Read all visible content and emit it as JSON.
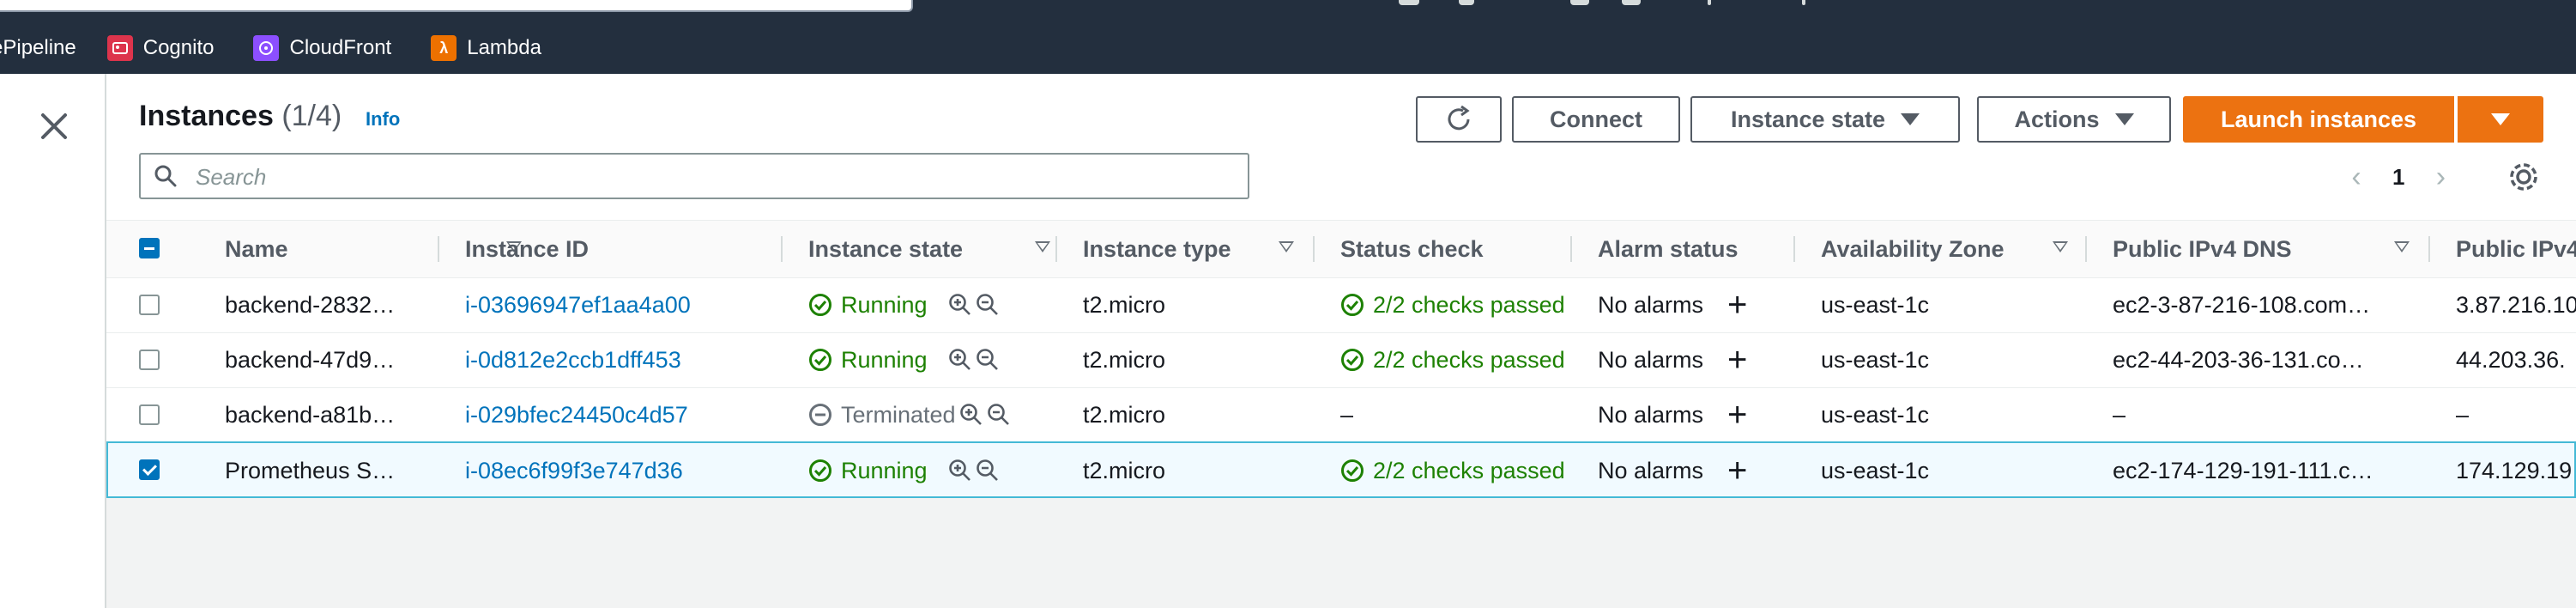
{
  "bookmarks": [
    {
      "label": "ePipeline",
      "icon": "codepipeline-icon",
      "color": ""
    },
    {
      "label": "Cognito",
      "icon": "cognito-icon",
      "color": "#dd344c"
    },
    {
      "label": "CloudFront",
      "icon": "cloudfront-icon",
      "color": "#8c4fff"
    },
    {
      "label": "Lambda",
      "icon": "lambda-icon",
      "color": "#ed7100"
    }
  ],
  "header": {
    "title": "Instances",
    "count": "(1/4)",
    "info": "Info"
  },
  "toolbar": {
    "connect": "Connect",
    "instance_state": "Instance state",
    "actions": "Actions",
    "launch": "Launch instances"
  },
  "search": {
    "placeholder": "Search"
  },
  "pagination": {
    "page": "1"
  },
  "table": {
    "columns": {
      "name": "Name",
      "instance_id": "Instance ID",
      "instance_state": "Instance state",
      "instance_type": "Instance type",
      "status_check": "Status check",
      "alarm_status": "Alarm status",
      "availability_zone": "Availability Zone",
      "public_dns": "Public IPv4 DNS",
      "public_ip": "Public IPv4"
    },
    "rows": [
      {
        "name": "backend-2832…",
        "id": "i-03696947ef1aa4a00",
        "state": "Running",
        "type": "t2.micro",
        "status": "2/2 checks passed",
        "alarm": "No alarms",
        "az": "us-east-1c",
        "dns": "ec2-3-87-216-108.com…",
        "ip": "3.87.216.10"
      },
      {
        "name": "backend-47d9…",
        "id": "i-0d812e2ccb1dff453",
        "state": "Running",
        "type": "t2.micro",
        "status": "2/2 checks passed",
        "alarm": "No alarms",
        "az": "us-east-1c",
        "dns": "ec2-44-203-36-131.co…",
        "ip": "44.203.36."
      },
      {
        "name": "backend-a81b…",
        "id": "i-029bfec24450c4d57",
        "state": "Terminated",
        "type": "t2.micro",
        "status": "–",
        "alarm": "No alarms",
        "az": "us-east-1c",
        "dns": "–",
        "ip": "–"
      },
      {
        "name": "Prometheus S…",
        "id": "i-08ec6f99f3e747d36",
        "state": "Running",
        "type": "t2.micro",
        "status": "2/2 checks passed",
        "alarm": "No alarms",
        "az": "us-east-1c",
        "dns": "ec2-174-129-191-111.c…",
        "ip": "174.129.19"
      }
    ]
  },
  "colors": {
    "topbar": "#232f3e",
    "link": "#0073bb",
    "success": "#1d8102",
    "primary": "#ec7211",
    "selected_row_bg": "#f1faff",
    "selected_row_border": "#44b9d6"
  }
}
